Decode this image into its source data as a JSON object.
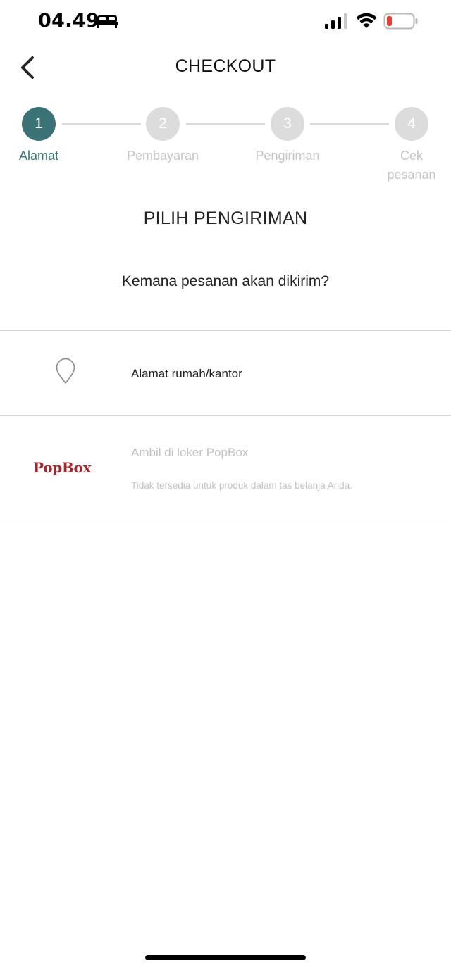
{
  "status_bar": {
    "time": "04.49",
    "icons": [
      "bed-icon",
      "signal-icon",
      "wifi-icon",
      "battery-icon"
    ],
    "signal_bars_filled": 3,
    "signal_bars_total": 4,
    "battery_color": "#e0423a"
  },
  "header": {
    "title": "CHECKOUT",
    "back_icon": "chevron-left-icon"
  },
  "stepper": {
    "active_color": "#3a7276",
    "inactive_color": "#dcdcdc",
    "steps": [
      {
        "number": "1",
        "label": "Alamat",
        "active": true
      },
      {
        "number": "2",
        "label": "Pembayaran",
        "active": false
      },
      {
        "number": "3",
        "label": "Pengiriman",
        "active": false
      },
      {
        "number": "4",
        "label": "Cek pesanan",
        "active": false
      }
    ]
  },
  "main": {
    "section_title": "PILIH PENGIRIMAN",
    "question": "Kemana pesanan akan dikirim?",
    "options": [
      {
        "icon": "location-pin-icon",
        "label": "Alamat rumah/kantor",
        "enabled": true
      },
      {
        "logo_text": "PopBox",
        "label": "Ambil di loker PopBox",
        "note": "Tidak tersedia untuk produk dalam tas belanja Anda.",
        "enabled": false,
        "logo_color": "#a3282d"
      }
    ]
  }
}
